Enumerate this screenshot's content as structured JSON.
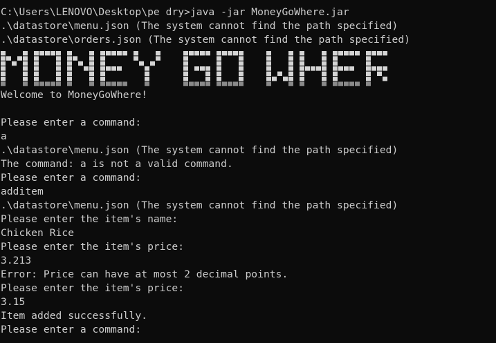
{
  "terminal": {
    "lines_before_banner": [
      "C:\\Users\\LENOVO\\Desktop\\pe dry>java -jar MoneyGoWhere.jar",
      ".\\datastore\\menu.json (The system cannot find the path specified)",
      ".\\datastore\\orders.json (The system cannot find the path specified)"
    ],
    "banner_text": "MONEY GO WHERE",
    "lines_after_banner": [
      "Welcome to MoneyGoWhere!",
      "",
      "Please enter a command:",
      "a",
      ".\\datastore\\menu.json (The system cannot find the path specified)",
      "The command: a is not a valid command.",
      "Please enter a command:",
      "additem",
      ".\\datastore\\menu.json (The system cannot find the path specified)",
      "Please enter the item's name:",
      "Chicken Rice",
      "Please enter the item's price:",
      "3.213",
      "Error: Price can have at most 2 decimal points.",
      "Please enter the item's price:",
      "3.15",
      "Item added successfully.",
      "Please enter a command:"
    ]
  },
  "colors": {
    "background": "#0c0c0c",
    "foreground": "#cccccc",
    "banner_fill": "#d4d4d4",
    "banner_shade": "#8a8a8a"
  }
}
